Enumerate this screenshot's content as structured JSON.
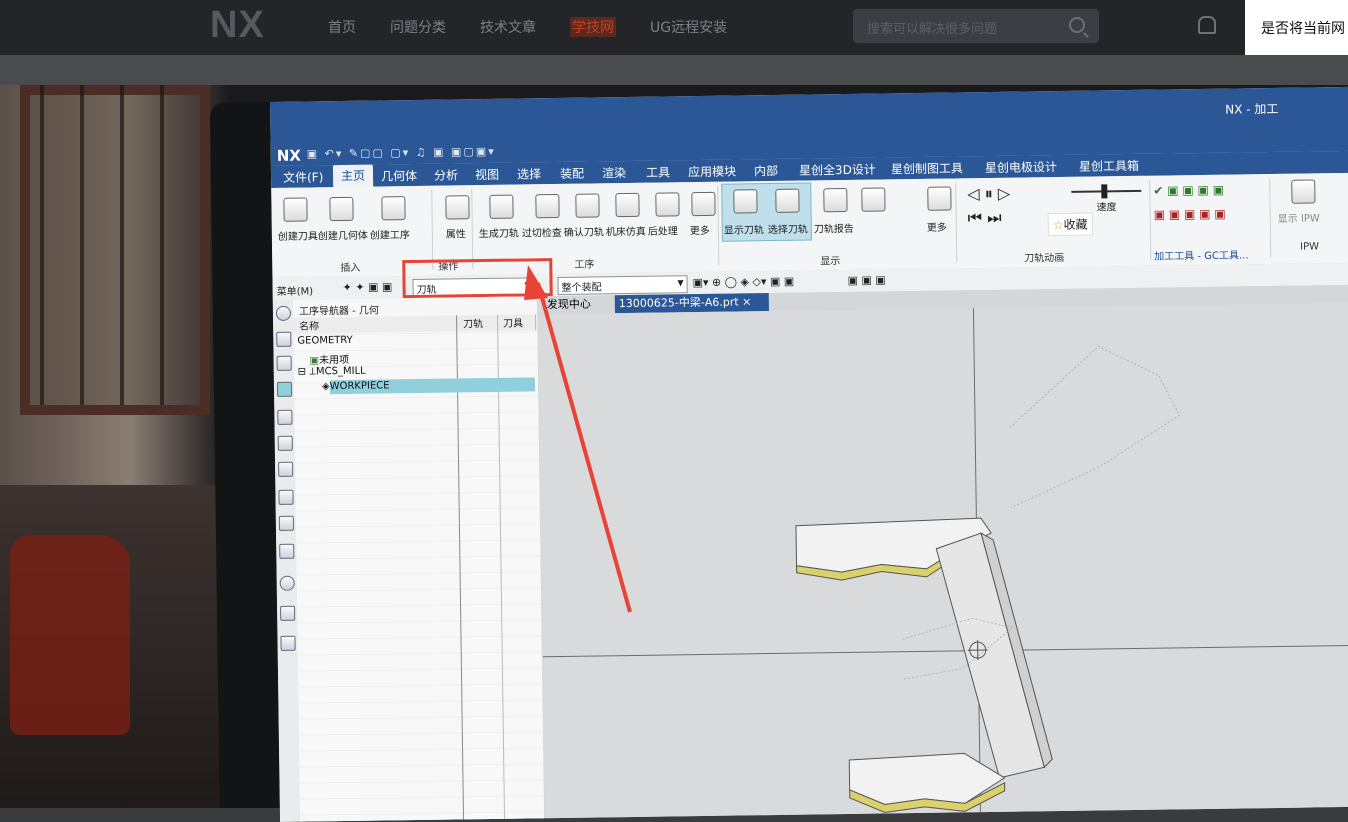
{
  "site": {
    "logo": "NX",
    "nav": [
      "首页",
      "问题分类",
      "技术文章",
      "学技网",
      "UG远程安装"
    ],
    "search_placeholder": "搜索可以解决很多问题",
    "popup_text": "是否将当前网"
  },
  "nx": {
    "window_title": "NX - 加工",
    "app_logo": "NX",
    "ribbon_tabs": [
      "文件(F)",
      "主页",
      "几何体",
      "分析",
      "视图",
      "选择",
      "装配",
      "渲染",
      "工具",
      "应用模块",
      "内部",
      "星创全3D设计",
      "星创制图工具",
      "星创电极设计",
      "星创工具箱"
    ],
    "active_tab": "主页",
    "insert_buttons": [
      "创建刀具",
      "创建几何体",
      "创建工序"
    ],
    "attr_button": "属性",
    "op_buttons": [
      "生成刀轨",
      "过切检查",
      "确认刀轨",
      "机床仿真",
      "后处理",
      "更多"
    ],
    "display_buttons": [
      "显示刀轨",
      "选择刀轨",
      "刀轨报告"
    ],
    "more_label": "更多",
    "speed_label": "速度",
    "favorite_label": "收藏",
    "right_tools": "加工工具 - GC工具...",
    "show_ipw": "显示 IPW",
    "ipw": "IPW",
    "group_labels": {
      "insert": "插入",
      "ops": "操作",
      "process": "工序",
      "display": "显示",
      "animation": "刀轨动画"
    },
    "menu_label": "菜单(M)",
    "filter_combo": "刀轨",
    "assembly_combo": "整个装配",
    "tabs": [
      "发现中心",
      "13000625-中梁-A6.prt"
    ],
    "navigator_title": "工序导航器 - 几何",
    "columns": [
      "名称",
      "刀轨",
      "刀具"
    ],
    "tree": [
      "GEOMETRY",
      "未用项",
      "MCS_MILL",
      "WORKPIECE"
    ]
  },
  "colors": {
    "accent": "#2b5797",
    "highlight": "#e84337",
    "selection": "#8fd0dc"
  }
}
